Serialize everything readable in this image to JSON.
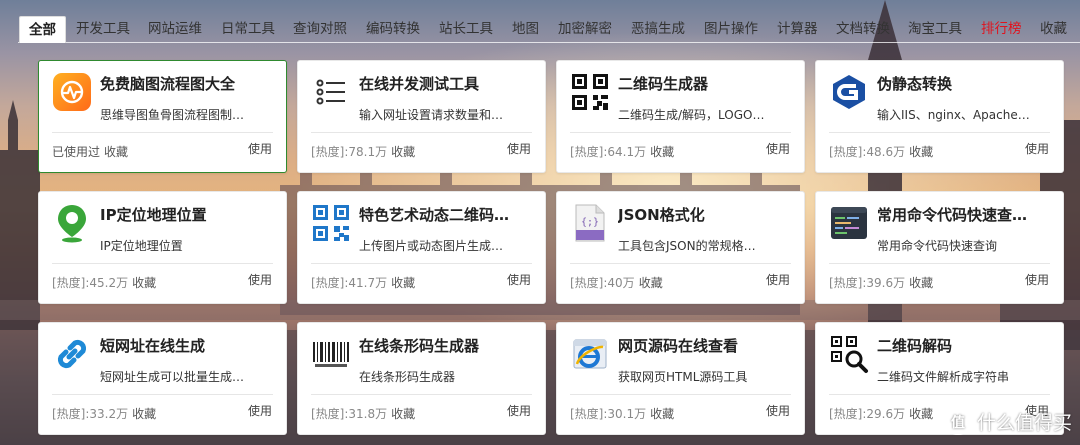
{
  "tabs": [
    {
      "label": "全部",
      "active": true
    },
    {
      "label": "开发工具"
    },
    {
      "label": "网站运维"
    },
    {
      "label": "日常工具"
    },
    {
      "label": "查询对照"
    },
    {
      "label": "编码转换"
    },
    {
      "label": "站长工具"
    },
    {
      "label": "地图"
    },
    {
      "label": "加密解密"
    },
    {
      "label": "恶搞生成"
    },
    {
      "label": "图片操作"
    },
    {
      "label": "计算器"
    },
    {
      "label": "文档转换"
    },
    {
      "label": "淘宝工具"
    },
    {
      "label": "排行榜",
      "color": "#e0141e"
    },
    {
      "label": "收藏"
    }
  ],
  "cards": [
    {
      "title": "免费脑图流程图大全",
      "desc": "思维导图鱼骨图流程图制…",
      "heat": "已使用过",
      "fav": "收藏",
      "use": "使用",
      "icon": "mindmap-app-icon"
    },
    {
      "title": "在线并发测试工具",
      "desc": "输入网址设置请求数量和…",
      "heat": "[热度]:78.1万",
      "fav": "收藏",
      "use": "使用",
      "icon": "list-icon"
    },
    {
      "title": "二维码生成器",
      "desc": "二维码生成/解码，LOGO…",
      "heat": "[热度]:64.1万",
      "fav": "收藏",
      "use": "使用",
      "icon": "qrcode-icon"
    },
    {
      "title": "伪静态转换",
      "desc": "输入IIS、nginx、Apache…",
      "heat": "[热度]:48.6万",
      "fav": "收藏",
      "use": "使用",
      "icon": "g-logo-icon"
    },
    {
      "title": "IP定位地理位置",
      "desc": "IP定位地理位置",
      "heat": "[热度]:45.2万",
      "fav": "收藏",
      "use": "使用",
      "icon": "map-pin-icon"
    },
    {
      "title": "特色艺术动态二维码…",
      "desc": "上传图片或动态图片生成…",
      "heat": "[热度]:41.7万",
      "fav": "收藏",
      "use": "使用",
      "icon": "blue-qrcode-icon"
    },
    {
      "title": "JSON格式化",
      "desc": "工具包含JSON的常规格…",
      "heat": "[热度]:40万",
      "fav": "收藏",
      "use": "使用",
      "icon": "json-file-icon"
    },
    {
      "title": "常用命令代码快速查…",
      "desc": "常用命令代码快速查询",
      "heat": "[热度]:39.6万",
      "fav": "收藏",
      "use": "使用",
      "icon": "code-editor-icon"
    },
    {
      "title": "短网址在线生成",
      "desc": "短网址生成可以批量生成…",
      "heat": "[热度]:33.2万",
      "fav": "收藏",
      "use": "使用",
      "icon": "link-icon"
    },
    {
      "title": "在线条形码生成器",
      "desc": "在线条形码生成器",
      "heat": "[热度]:31.8万",
      "fav": "收藏",
      "use": "使用",
      "icon": "barcode-icon"
    },
    {
      "title": "网页源码在线查看",
      "desc": "获取网页HTML源码工具",
      "heat": "[热度]:30.1万",
      "fav": "收藏",
      "use": "使用",
      "icon": "ie-browser-icon"
    },
    {
      "title": "二维码解码",
      "desc": "二维码文件解析成字符串",
      "heat": "[热度]:29.6万",
      "fav": "收藏",
      "use": "使用",
      "icon": "qrcode-search-icon"
    }
  ],
  "watermark": {
    "logo": "值",
    "text": "什么值得买"
  }
}
